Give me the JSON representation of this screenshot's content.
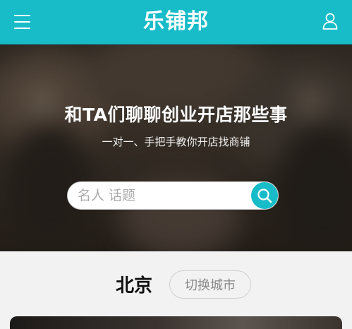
{
  "header": {
    "logo_text": "乐铺邦",
    "menu_icon": "hamburger-menu-icon",
    "user_icon": "user-icon",
    "brand_color": "#17bcc8"
  },
  "hero": {
    "title": "和TA们聊聊创业开店那些事",
    "subtitle": "一对一、手把手教你开店找商铺",
    "search": {
      "placeholder": "名人 话题",
      "value": "",
      "button_icon": "search-icon"
    }
  },
  "city": {
    "current": "北京",
    "switch_label": "切换城市"
  }
}
